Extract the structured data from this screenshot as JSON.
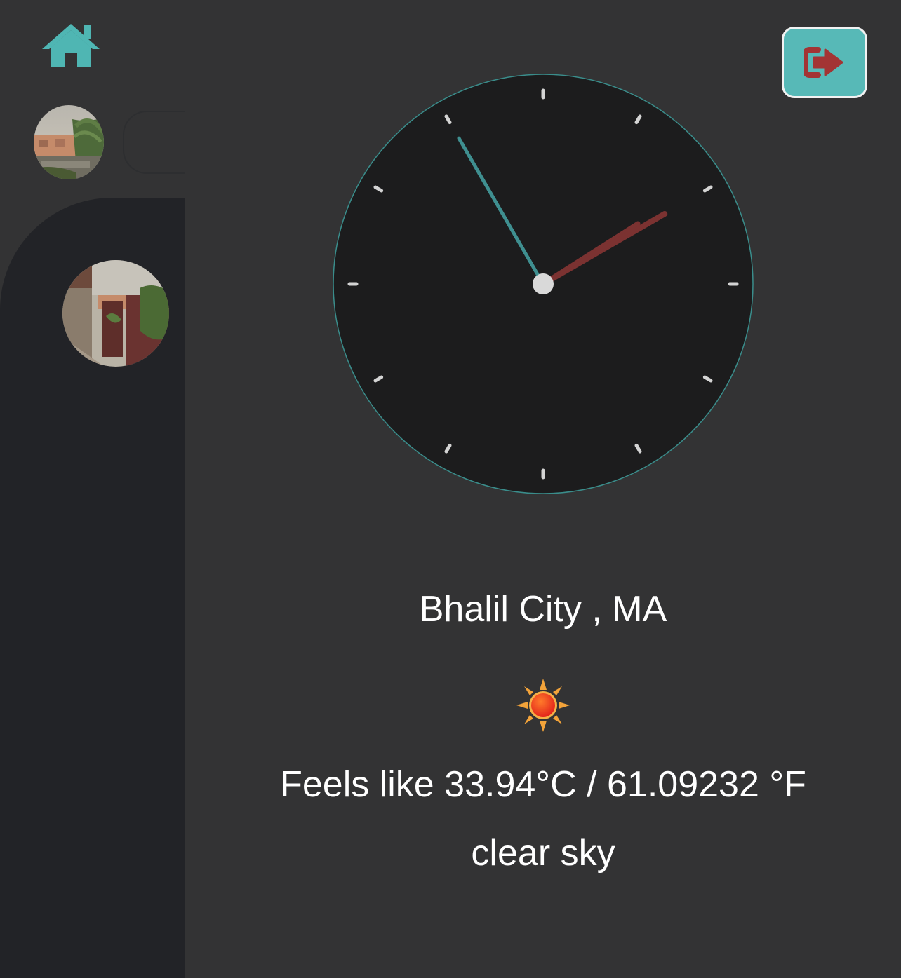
{
  "nav": {
    "home_icon": "home-icon",
    "home_color": "#4fb6b3",
    "logout_icon": "logout-icon",
    "logout_bg": "#57b9b7",
    "logout_icon_color": "#a33434"
  },
  "sidebar": {
    "avatars": [
      {
        "name": "profile-photo-palms"
      },
      {
        "name": "photo-rooftops"
      }
    ]
  },
  "clock": {
    "face_color": "#1c1c1d",
    "border_color": "#3a8d8b",
    "minute_hand_color": "#3f8f90",
    "hour_hand_color": "#7b3231",
    "second_hand_color": "#7b3231",
    "hour": 1,
    "minute": 55,
    "second": 10
  },
  "weather": {
    "location": "Bhalil City , MA",
    "icon": "sun-icon",
    "feels_like": "Feels like 33.94°C / 61.09232 °F",
    "description": "clear sky"
  }
}
